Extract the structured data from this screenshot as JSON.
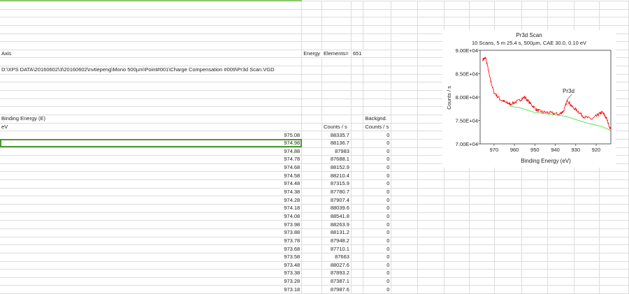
{
  "sheet": {
    "axis_label": "Axis",
    "energy_label": "Energy",
    "elements_label": "Elements=",
    "elements_count": "651",
    "file_path": "D:\\XPS DATA\\20160602\\3\\20160602\\nvtiepeng\\Mono 500µm\\Point#001\\Charge Compensation #009\\Pr3d Scan.VGD",
    "col_a_header": "Binding Energy (E)",
    "col_a_unit": "eV",
    "col_c_header": "Counts / s",
    "col_e_header": "Backgnd.",
    "col_e_unit": "Counts / s",
    "rows": [
      {
        "e": "975.08",
        "c": "88335.7",
        "b": "0"
      },
      {
        "e": "974.98",
        "c": "88136.7",
        "b": "0"
      },
      {
        "e": "974.88",
        "c": "87983",
        "b": "0"
      },
      {
        "e": "974.78",
        "c": "87688.1",
        "b": "0"
      },
      {
        "e": "974.68",
        "c": "88152.9",
        "b": "0"
      },
      {
        "e": "974.58",
        "c": "88210.4",
        "b": "0"
      },
      {
        "e": "974.48",
        "c": "87315.9",
        "b": "0"
      },
      {
        "e": "974.38",
        "c": "87780.7",
        "b": "0"
      },
      {
        "e": "974.28",
        "c": "87907.4",
        "b": "0"
      },
      {
        "e": "974.18",
        "c": "88039.6",
        "b": "0"
      },
      {
        "e": "974.08",
        "c": "88541.8",
        "b": "0"
      },
      {
        "e": "973.98",
        "c": "88263.9",
        "b": "0"
      },
      {
        "e": "973.88",
        "c": "88131.2",
        "b": "0"
      },
      {
        "e": "973.78",
        "c": "87948.2",
        "b": "0"
      },
      {
        "e": "973.68",
        "c": "87710.1",
        "b": "0"
      },
      {
        "e": "973.58",
        "c": "87663",
        "b": "0"
      },
      {
        "e": "973.48",
        "c": "88027.6",
        "b": "0"
      },
      {
        "e": "973.38",
        "c": "87893.2",
        "b": "0"
      },
      {
        "e": "973.28",
        "c": "87387.1",
        "b": "0"
      },
      {
        "e": "973.18",
        "c": "87987.6",
        "b": "0"
      }
    ]
  },
  "chart_data": {
    "type": "line",
    "title": "Pr3d Scan",
    "subtitle": "10 Scans,  5 m 25.4 s,  500µm,  CAE 30.0,  0.10 eV",
    "xlabel": "Binding Energy (eV)",
    "ylabel": "Counts / s",
    "xlim": [
      976.8,
      912.8
    ],
    "ylim": [
      70000,
      90000
    ],
    "xticks": [
      "970",
      "960",
      "950",
      "940",
      "930",
      "920"
    ],
    "xtick_values": [
      970,
      960,
      950,
      940,
      930,
      920
    ],
    "yticks": [
      "7.00E+04",
      "7.50E+04",
      "8.00E+04",
      "8.50E+04",
      "9.00E+04"
    ],
    "ytick_values": [
      70000,
      75000,
      80000,
      85000,
      90000
    ],
    "annotation": "Pr3d",
    "annotation_at": [
      934,
      79400
    ],
    "series": [
      {
        "name": "Pr3d",
        "color": "#ff0000",
        "x": [
          975.5,
          974,
          972,
          970,
          967,
          964,
          962,
          958,
          955,
          952,
          949,
          946,
          942,
          938,
          936,
          934,
          932,
          929,
          926,
          922,
          919,
          917,
          915,
          912.8
        ],
        "y": [
          88000,
          88400,
          84000,
          81000,
          79500,
          78800,
          78500,
          79200,
          80000,
          78500,
          77200,
          76800,
          76600,
          76300,
          77000,
          79400,
          78000,
          77000,
          75800,
          75300,
          76200,
          76800,
          75500,
          73000
        ]
      },
      {
        "name": "Background",
        "color": "#33dd33",
        "x": [
          962,
          958,
          950,
          940,
          935,
          925,
          918,
          915,
          912.8
        ],
        "y": [
          78000,
          77800,
          76700,
          76200,
          75900,
          74500,
          73800,
          73300,
          72800
        ]
      }
    ]
  }
}
